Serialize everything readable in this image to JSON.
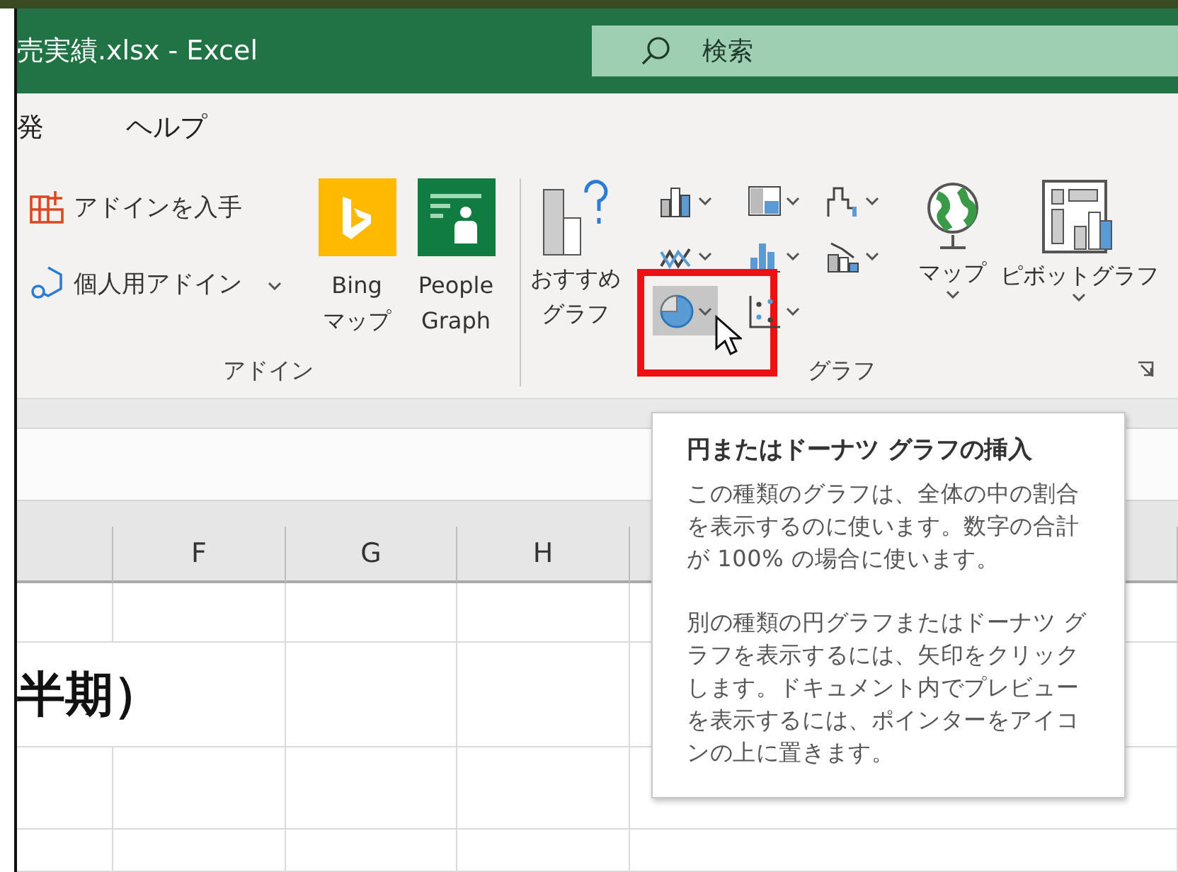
{
  "window": {
    "title": "売実績.xlsx  -  Excel"
  },
  "search": {
    "placeholder": "検索"
  },
  "tabs": [
    {
      "label": "発",
      "selected": false
    },
    {
      "label": "ヘルプ",
      "selected": false
    }
  ],
  "addins_group": {
    "label": "アドイン",
    "get_addins": "アドインを入手",
    "my_addins": "個人用アドイン",
    "tiles": [
      {
        "kind": "bing",
        "lines": [
          "Bing",
          "マップ"
        ]
      },
      {
        "kind": "people",
        "lines": [
          "People",
          "Graph"
        ]
      }
    ]
  },
  "charts_group": {
    "label": "グラフ",
    "recommended": [
      "おすすめ",
      "グラフ"
    ],
    "chart_buttons": [
      {
        "kind": "column",
        "selected": false
      },
      {
        "kind": "hierarchy",
        "selected": false
      },
      {
        "kind": "waterfall",
        "selected": false
      },
      {
        "kind": "line",
        "selected": false
      },
      {
        "kind": "statistic",
        "selected": false
      },
      {
        "kind": "combo",
        "selected": false
      },
      {
        "kind": "pie",
        "selected": true
      },
      {
        "kind": "scatter",
        "selected": false
      }
    ],
    "map": "マップ",
    "pivot_chart": "ピボットグラフ"
  },
  "sheet": {
    "columns": [
      "F",
      "G",
      "H"
    ],
    "title_cell": "半期）"
  },
  "tooltip": {
    "title": "円またはドーナツ グラフの挿入",
    "paragraphs": [
      "この種類のグラフは、全体の中の割合を表示するのに使います。数字の合計が 100% の場合に使います。",
      "別の種類の円グラフまたはドーナツ グラフを表示するには、矢印をクリックします。ドキュメント内でプレビューを表示するには、ポインターをアイコンの上に置きます。"
    ]
  }
}
